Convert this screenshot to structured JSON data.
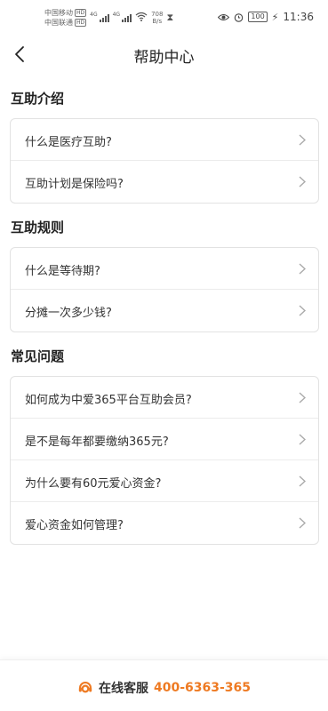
{
  "status_bar": {
    "carrier1": "中国移动",
    "carrier2": "中国联通",
    "hd": "HD",
    "net1": "4G",
    "net2": "4G",
    "speed_value": "708",
    "speed_unit": "B/s",
    "battery": "100",
    "time": "11:36"
  },
  "header": {
    "title": "帮助中心",
    "back_icon": "chevron-left-icon"
  },
  "sections": [
    {
      "title": "互助介绍",
      "items": [
        "什么是医疗互助?",
        "互助计划是保险吗?"
      ]
    },
    {
      "title": "互助规则",
      "items": [
        "什么是等待期?",
        "分摊一次多少钱?"
      ]
    },
    {
      "title": "常见问题",
      "items": [
        "如何成为中爱365平台互助会员?",
        "是不是每年都要缴纳365元?",
        "为什么要有60元爱心资金?",
        "爱心资金如何管理?"
      ]
    }
  ],
  "footer": {
    "label": "在线客服",
    "phone": "400-6363-365",
    "icon": "customer-service-icon"
  },
  "colors": {
    "accent": "#ee7a22",
    "text": "#222222",
    "border": "#e2e2e2"
  }
}
